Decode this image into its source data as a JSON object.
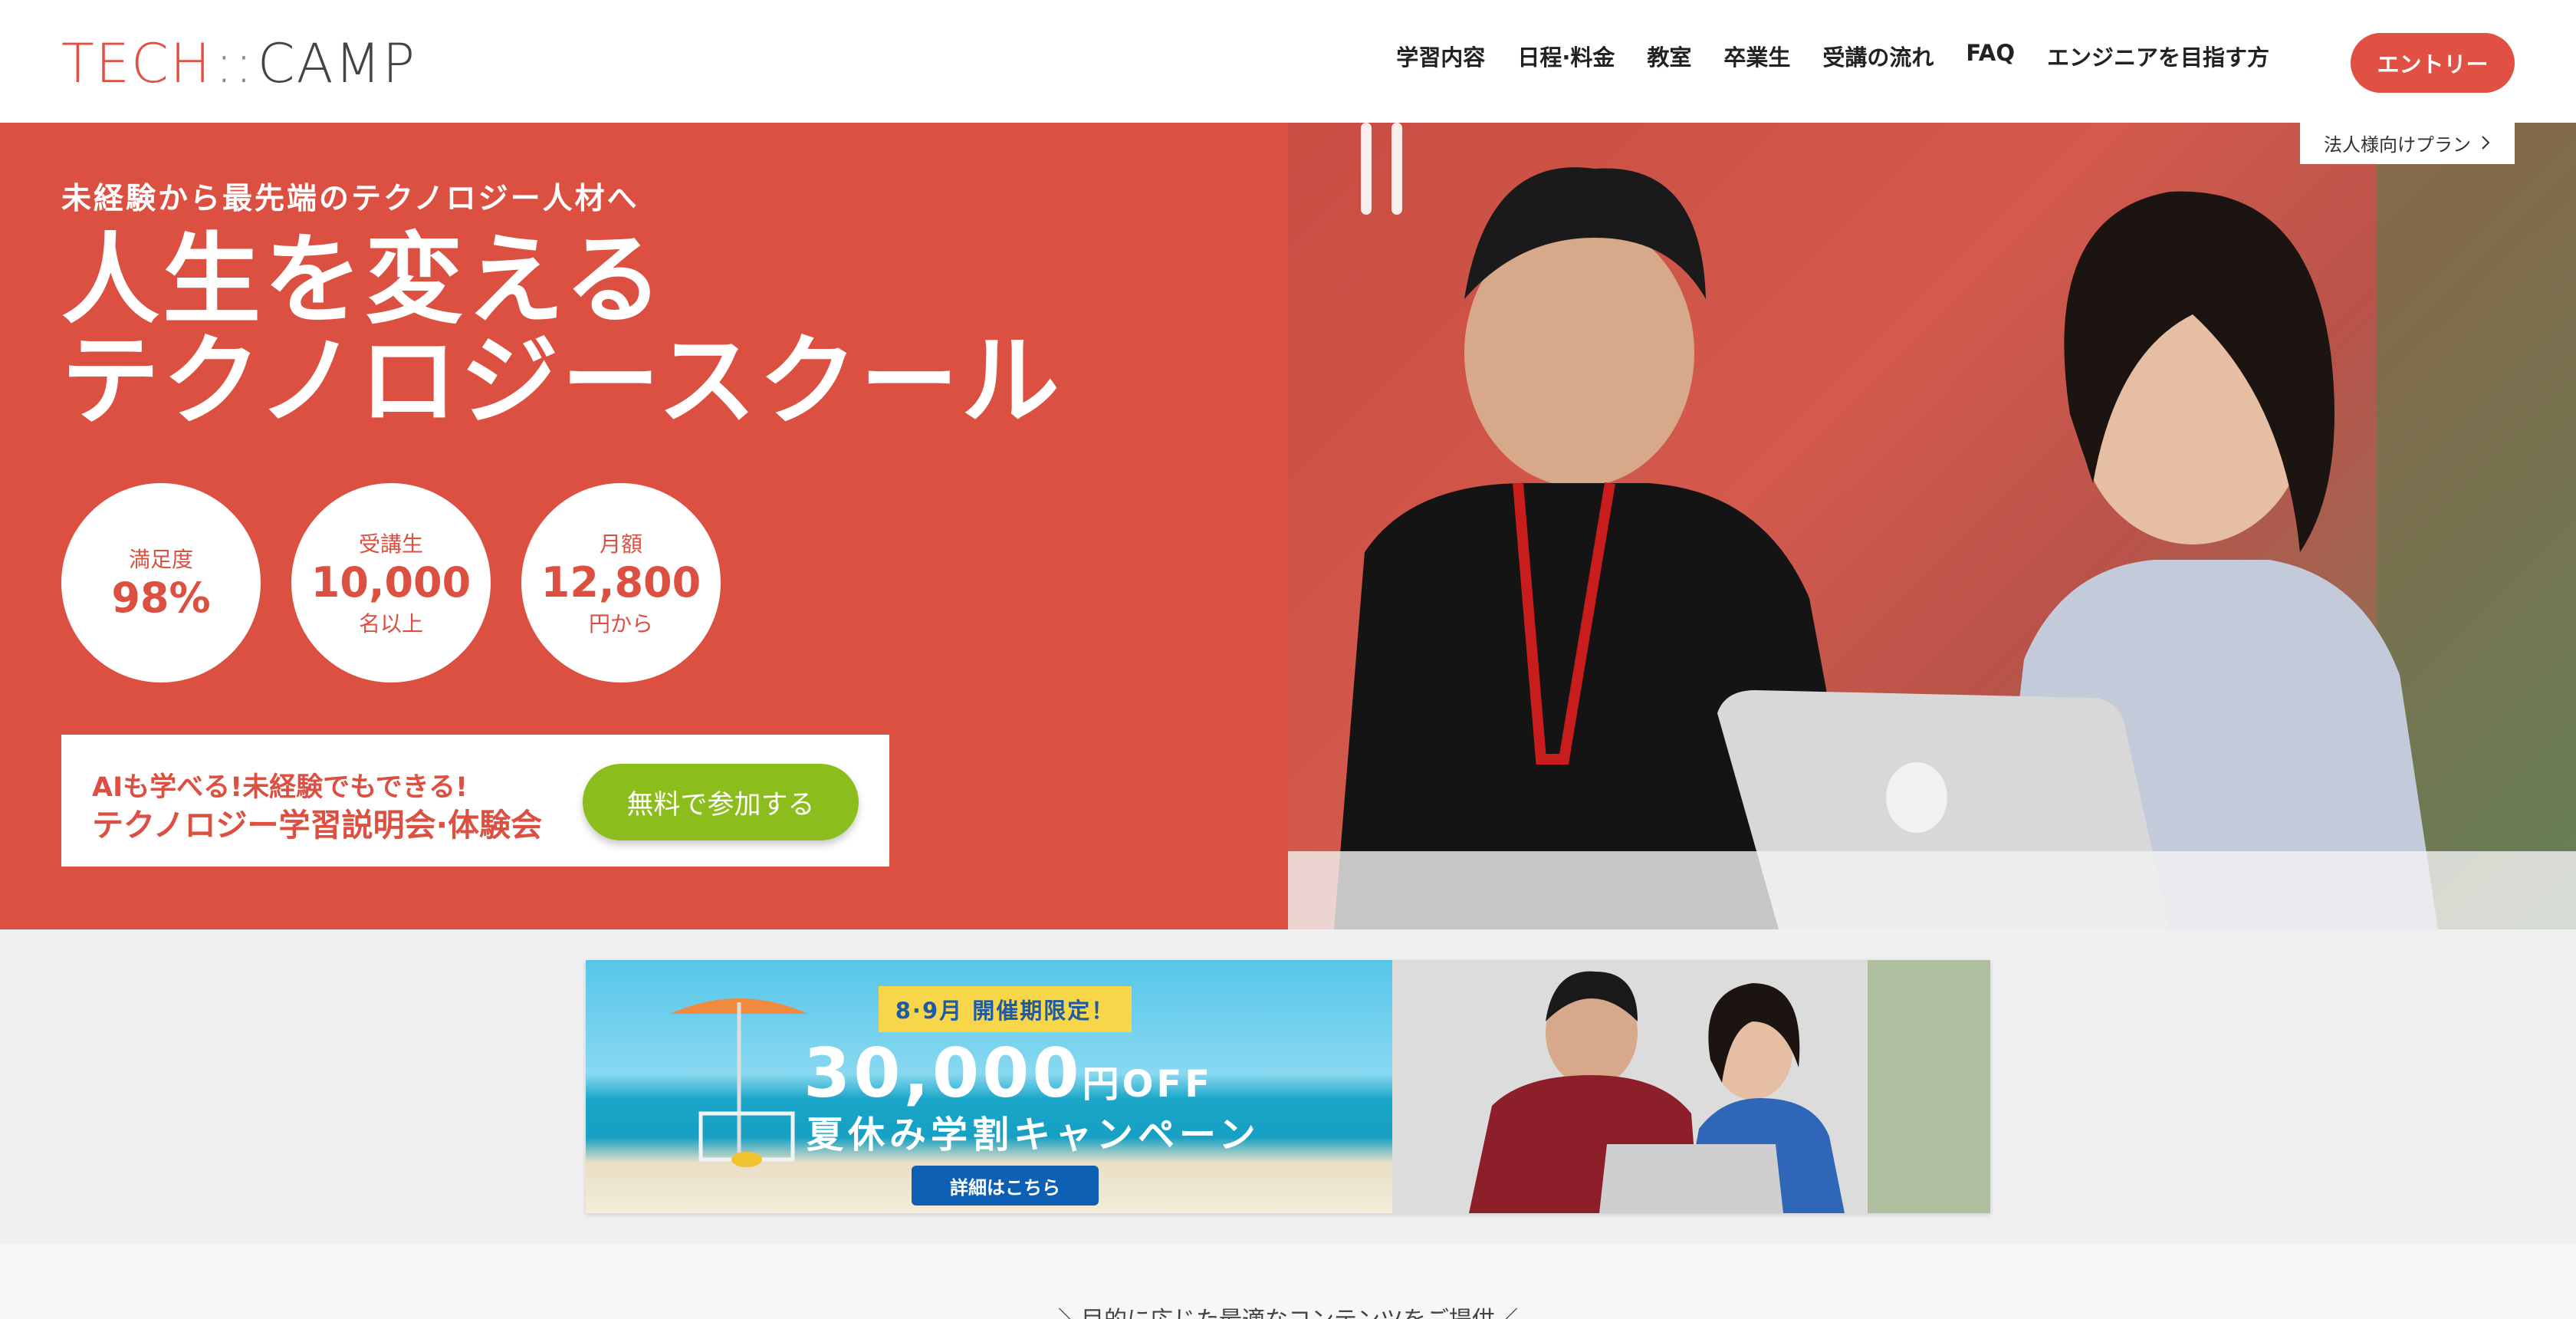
{
  "header": {
    "logo_left": "TECH",
    "logo_sep": "::",
    "logo_right": "CAMP",
    "nav": [
      "学習内容",
      "日程·料金",
      "教室",
      "卒業生",
      "受講の流れ",
      "FAQ",
      "エンジニアを目指す方"
    ],
    "entry_label": "エントリー"
  },
  "hero": {
    "corporate_link": "法人様向けプラン",
    "tagline": "未経験から最先端のテクノロジー人材へ",
    "title_line1": "人生を変える",
    "title_line2": "テクノロジースクール",
    "stats": [
      {
        "label": "満足度",
        "value": "98%",
        "sub": ""
      },
      {
        "label": "受講生",
        "value": "10,000",
        "sub": "名以上"
      },
      {
        "label": "月額",
        "value": "12,800",
        "sub": "円から"
      }
    ],
    "cta": {
      "line1": "AIも学べる!未経験でもできる!",
      "line2": "テクノロジー学習説明会·体験会",
      "button": "無料で参加する"
    }
  },
  "banner": {
    "badge": "8·9月 開催期限定！",
    "amount": "30,000",
    "amount_unit": "円OFF",
    "title": "夏休み学割キャンペーン",
    "button": "詳細はこちら"
  },
  "section": {
    "heading": "＼目的に応じた最適なコンテンツをご提供／"
  },
  "colors": {
    "brand_red": "#dc5042",
    "cta_green": "#8bbd1c",
    "promo_blue": "#0d5fb3",
    "promo_yellow": "#f7d64a"
  }
}
